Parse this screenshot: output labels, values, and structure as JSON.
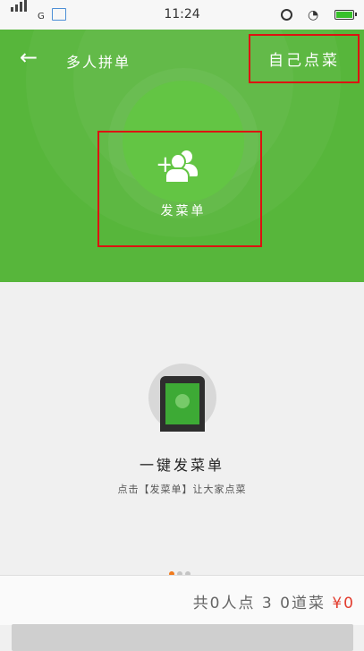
{
  "status_bar": {
    "carrier": "G",
    "time": "11:24",
    "icons": [
      "signal-icon",
      "image-notification-icon",
      "alarm-icon",
      "wifi-icon",
      "battery-icon"
    ]
  },
  "header": {
    "back_icon": "arrow-left-icon",
    "title": "多人拼单",
    "self_order_label": "自己点菜"
  },
  "hero": {
    "icon": "add-group-icon",
    "button_label": "发菜单"
  },
  "guide": {
    "icon": "phone-wechat-icon",
    "title": "一键发菜单",
    "subtitle": "点击【发菜单】让大家点菜",
    "page_count": 3,
    "active_page": 1
  },
  "footer": {
    "summary": "共0人点 3 0道菜",
    "price": "¥0"
  },
  "colors": {
    "header_green": "#57b63b",
    "price_red": "#e23c2e",
    "indicator_orange": "#f07b1e"
  }
}
